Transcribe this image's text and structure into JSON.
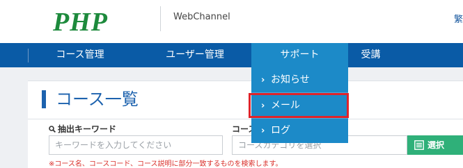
{
  "header": {
    "logo": "PHP",
    "channel": "WebChannel",
    "right_text": "繁"
  },
  "nav": {
    "items": [
      {
        "label": "コース管理"
      },
      {
        "label": "ユーザー管理"
      },
      {
        "label": "サポート"
      },
      {
        "label": "受講"
      }
    ],
    "active_index": 2
  },
  "dropdown": {
    "items": [
      {
        "label": "お知らせ"
      },
      {
        "label": "メール"
      },
      {
        "label": "ログ"
      }
    ],
    "highlighted_index": 1
  },
  "main": {
    "title": "コース一覧",
    "keyword_label": "抽出キーワード",
    "keyword_placeholder": "キーワードを入力してください",
    "category_label": "コース",
    "category_placeholder": "コースカテゴリを選択",
    "select_button": "選択",
    "note": "※コース名、コースコード、コース説明に部分一致するものを検索します。"
  },
  "colors": {
    "nav_bg": "#0a5ba6",
    "active_bg": "#1c8ac8",
    "logo": "#1d8a3c",
    "title": "#1c62ae",
    "select_button": "#2fb079",
    "highlight": "#e0232a",
    "note": "#d9302b"
  }
}
